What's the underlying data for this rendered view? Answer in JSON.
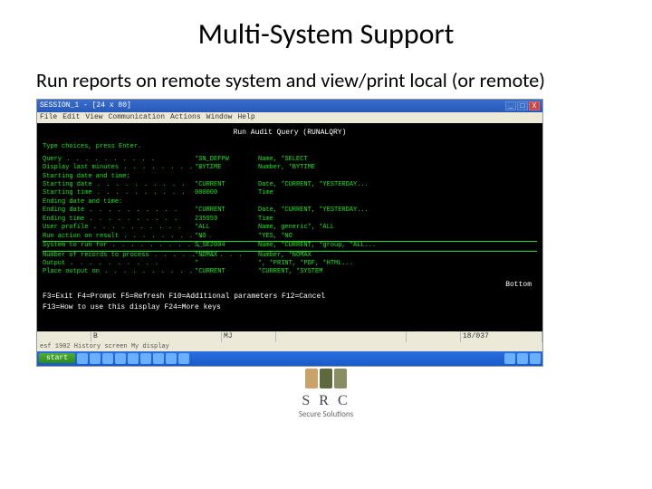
{
  "slide": {
    "title": "Multi-System Support",
    "body": "Run reports on remote system and view/print local (or remote)"
  },
  "window": {
    "title": "SESSION_1 - [24 x 80]",
    "menus": [
      "File",
      "Edit",
      "View",
      "Communication",
      "Actions",
      "Window",
      "Help"
    ],
    "close_x": "X"
  },
  "terminal": {
    "title": "Run Audit Query (RUNALQRY)",
    "prompt": "Type choices, press Enter.",
    "rows": [
      {
        "label": "Query",
        "value": "*SN_DEFPW",
        "hint": "Name, *SELECT"
      },
      {
        "label": "Display last minutes",
        "value": "*BYTIME",
        "hint": "Number, *BYTIME"
      },
      {
        "label": "Starting date and time:",
        "section": true
      },
      {
        "label": "  Starting date",
        "value": "*CURRENT",
        "hint": "Date, *CURRENT, *YESTERDAY..."
      },
      {
        "label": "  Starting time",
        "value": "000000",
        "hint": "Time"
      },
      {
        "label": "Ending date and time:",
        "section": true
      },
      {
        "label": "  Ending date",
        "value": "*CURRENT",
        "hint": "Date, *CURRENT, *YESTERDAY..."
      },
      {
        "label": "  Ending time",
        "value": "235959",
        "hint": "Time"
      },
      {
        "label": "User profile",
        "value": "*ALL",
        "hint": "Name, generic*, *ALL"
      },
      {
        "label": "Run action on result",
        "value": "*NO",
        "hint": "*YES, *NO"
      },
      {
        "label": "System to run for",
        "value": "S_SE2004",
        "hint": "Name, *CURRENT, *group, *ALL...",
        "highlight": true
      },
      {
        "label": "Number of records to process",
        "value": "*NOMAX",
        "hint": "Number, *NOMAX"
      },
      {
        "label": "Output",
        "value": "*",
        "hint": "*, *PRINT, *PDF, *HTML..."
      },
      {
        "label": "Place output on",
        "value": "*CURRENT",
        "hint": "*CURRENT, *SYSTEM"
      }
    ],
    "bottom": "Bottom",
    "fkeys_line1": "F3=Exit   F4=Prompt   F5=Refresh   F10=Additional parameters   F12=Cancel",
    "fkeys_line2": "F13=How to use this display        F24=More keys"
  },
  "statusbar": {
    "a": "",
    "b": "B",
    "m": "MJ",
    "c": "",
    "d": "",
    "pos": "18/037"
  },
  "history": "esf 1902 History screen My display",
  "taskbar": {
    "start": "start",
    "tray_count": 9
  },
  "logo": {
    "text": "S R C",
    "subtitle": "Secure Solutions",
    "colors": [
      "#c9a36a",
      "#5e6a3e",
      "#8a8f63"
    ]
  }
}
